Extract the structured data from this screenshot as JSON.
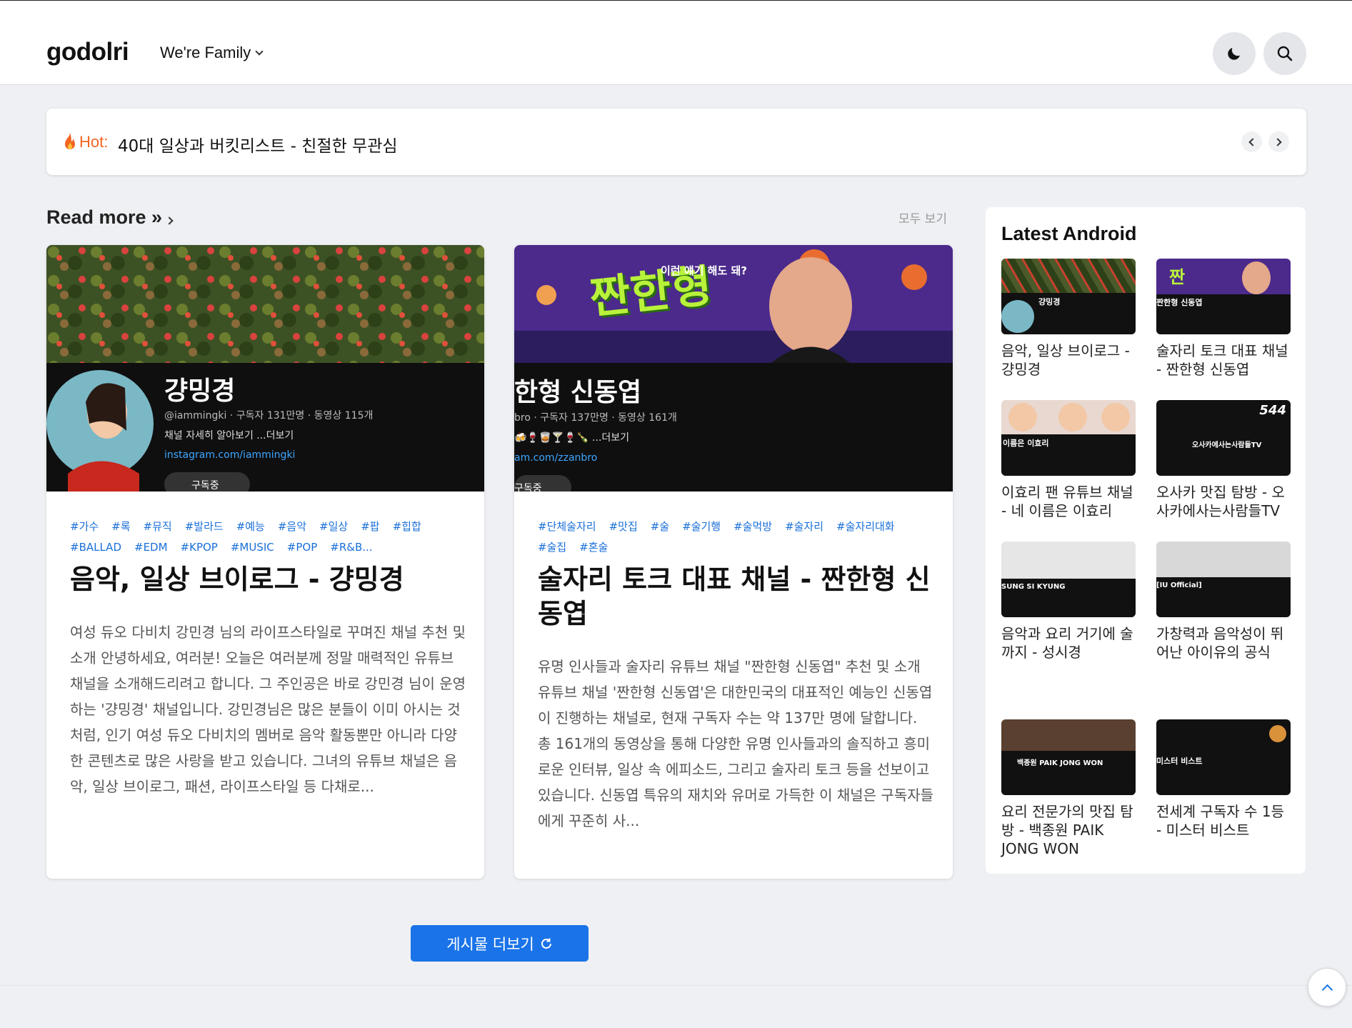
{
  "top_dots": "...",
  "header": {
    "logo": "godolri",
    "family_menu": "We're Family",
    "icons": {
      "theme": "moon-icon",
      "search": "search-icon"
    }
  },
  "hot": {
    "label": "Hot:",
    "text": "40대 일상과 버킷리스트 - 친절한 무관심"
  },
  "section": {
    "title": "Read more »",
    "view_all": "모두 보기"
  },
  "posts": [
    {
      "tags": [
        "#가수",
        "#록",
        "#뮤직",
        "#발라드",
        "#예능",
        "#음악",
        "#일상",
        "#팝",
        "#힙합",
        "#BALLAD",
        "#EDM",
        "#KPOP",
        "#MUSIC",
        "#POP",
        "#R&B..."
      ],
      "title": "음악, 일상 브이로그 - 걍밍경",
      "desc": "여성 듀오 다비치 강민경 님의 라이프스타일로 꾸며진 채널 추천 및 소개 안녕하세요, 여러분! 오늘은 여러분께 정말 매력적인 유튜브 채널을 소개해드리려고 합니다. 그 주인공은 바로 강민경 님이 운영하는 '걍밍경' 채널입니다. 강민경님은 많은 분들이 이미 아시는 것처럼, 인기 여성 듀오 다비치의 멤버로 음악 활동뿐만 아니라 다양한 콘텐츠로 많은 사랑을 받고 있습니다. 그녀의 유튜브 채널은 음악, 일상 브이로그, 패션, 라이프스타일 등 다채로...",
      "thumb": {
        "channel_name": "걍밍경",
        "handle": "@iammingki · 구독자 131만명 · 동영상 115개",
        "about": "채널 자세히 알아보기 ...더보기",
        "link": "instagram.com/iammingki",
        "subscribe": "구독중"
      }
    },
    {
      "tags": [
        "#단체술자리",
        "#맛집",
        "#술",
        "#술기행",
        "#술먹방",
        "#술자리",
        "#술자리대화",
        "#술집",
        "#혼술"
      ],
      "title": "술자리 토크 대표 채널 - 짠한형 신동엽",
      "desc": "유명 인사들과 술자리 유튜브 채널 \"짠한형 신동엽\" 추천 및 소개  유튜브 채널 '짠한형 신동엽'은 대한민국의 대표적인 예능인 신동엽이 진행하는 채널로, 현재 구독자 수는 약 137만 명에 달합니다. 총 161개의 동영상을 통해 다양한 유명 인사들과의 솔직하고 흥미로운 인터뷰, 일상 속 에피소드, 그리고 술자리 토크 등을 선보이고 있습니다. 신동엽 특유의 재치와 유머로 가득한 이 채널은 구독자들에게 꾸준히 사...",
      "thumb": {
        "banner_text": "짠한형",
        "banner_sub": "이런 얘기 해도 돼?",
        "channel_name": "한형 신동엽",
        "handle": "bro · 구독자 137만명 · 동영상 161개",
        "about": "🍻🍷🥃🍸🍷🍾 ...더보기",
        "link": "am.com/zzanbro",
        "subscribe": "구독중"
      }
    }
  ],
  "load_more": "게시물 더보기",
  "sidebar": {
    "title": "Latest Android",
    "items": [
      {
        "label": "음악, 일상 브이로그 - 걍밍경",
        "thumb_text": "걍밍경"
      },
      {
        "label": "술자리 토크 대표 채널 - 짠한형 신동엽",
        "thumb_text": "짠한형 신동엽"
      },
      {
        "label": "이효리 팬 유튜브 채널 - 네 이름은 이효리",
        "thumb_text": "이름은 이효리"
      },
      {
        "label": "오사카 맛집 탐방 - 오사카에사는사람들TV",
        "thumb_text": "오사카에사는사람들TV"
      },
      {
        "label": "음악과 요리 거기에 술까지 - 성시경",
        "thumb_text": "SUNG SI KYUNG"
      },
      {
        "label": "가창력과 음악성이 뛰어난 아이유의 공식",
        "thumb_text": "[IU Official]"
      },
      {
        "label": "요리 전문가의 맛집 탐방 - 백종원 PAIK JONG WON",
        "thumb_text": "백종원 PAIK JONG WON"
      },
      {
        "label": "전세계 구독자 수 1등 - 미스터 비스트",
        "thumb_text": "미스터 비스트"
      }
    ]
  },
  "colors": {
    "accent": "#1a73e8",
    "hot": "#f26522",
    "tag": "#1a6fd8"
  }
}
